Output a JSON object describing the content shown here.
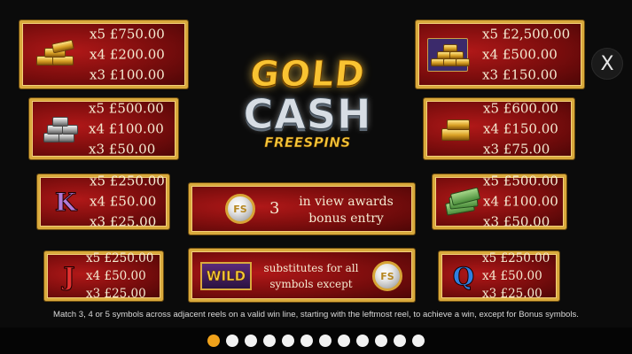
{
  "logo": {
    "line1": "GOLD",
    "line2": "CASH",
    "line3": "FREESPINS"
  },
  "close": {
    "label": "X"
  },
  "paytable": [
    {
      "id": "gold-bars",
      "icon": "gold-bars-icon",
      "pays": [
        "x5 £750.00",
        "x4 £200.00",
        "x3 £100.00"
      ]
    },
    {
      "id": "gold-pile",
      "icon": "gold-pile-icon",
      "pays": [
        "x5 £2,500.00",
        "x4 £500.00",
        "x3 £150.00"
      ]
    },
    {
      "id": "silver-bars",
      "icon": "silver-bars-icon",
      "pays": [
        "x5 £500.00",
        "x4 £100.00",
        "x3 £50.00"
      ]
    },
    {
      "id": "gold-bar",
      "icon": "gold-bar-icon",
      "pays": [
        "x5 £600.00",
        "x4 £150.00",
        "x3 £75.00"
      ]
    },
    {
      "id": "k",
      "letter": "K",
      "pays": [
        "x5 £250.00",
        "x4 £50.00",
        "x3 £25.00"
      ]
    },
    {
      "id": "cash-stack",
      "icon": "cash-stack-icon",
      "pays": [
        "x5 £500.00",
        "x4 £100.00",
        "x3 £50.00"
      ]
    },
    {
      "id": "j",
      "letter": "J",
      "pays": [
        "x5 £250.00",
        "x4 £50.00",
        "x3 £25.00"
      ]
    },
    {
      "id": "q",
      "letter": "Q",
      "pays": [
        "x5 £250.00",
        "x4 £50.00",
        "x3 £25.00"
      ]
    }
  ],
  "bonus": {
    "count": "3",
    "line1": "in view awards",
    "line2": "bonus entry",
    "coin": "FS"
  },
  "wild": {
    "badge": "WILD",
    "line1": "substitutes for all",
    "line2": "symbols except",
    "coin": "FS"
  },
  "rule": "Match 3, 4 or 5 symbols across adjacent reels on a valid win line, starting with the leftmost reel, to achieve a win, except for Bonus symbols.",
  "pagination": {
    "total": 12,
    "active": 0
  },
  "colors": {
    "panel_red": "#a01414",
    "gold_border": "#d9a93c",
    "active_dot": "#f0a21b",
    "dot": "#f2f2f2"
  }
}
